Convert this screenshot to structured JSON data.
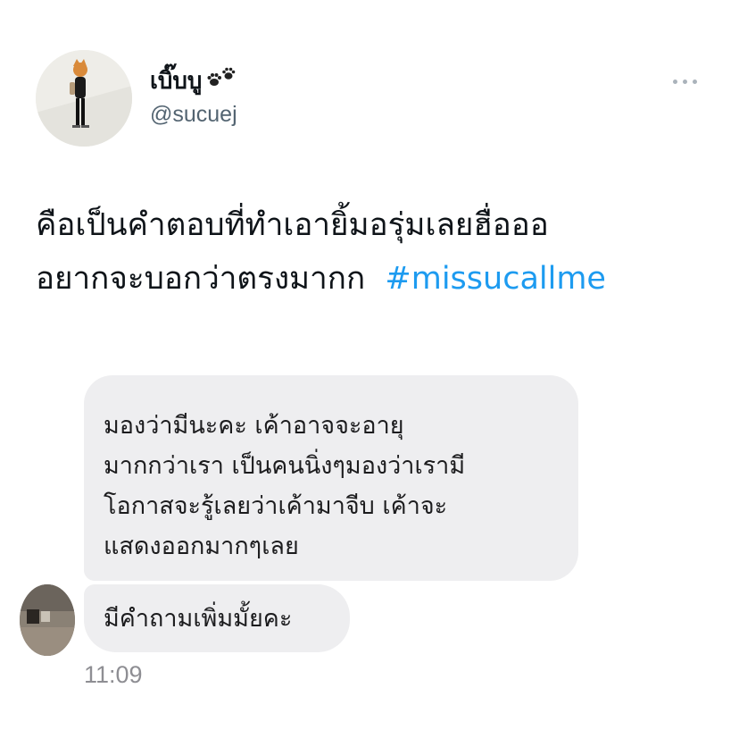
{
  "tweet": {
    "display_name": "เบิ๊บบู",
    "handle": "@sucuej",
    "text_lines": [
      "คือเป็นคำตอบที่ทำเอายิ้มอรุ่มเลยฮื่อออ",
      "อยากจะบอกว่าตรงมากก"
    ],
    "hashtag": "#missucallme",
    "icons": {
      "name_emoji": "paw-prints-icon",
      "menu": "more-icon"
    }
  },
  "chat": {
    "message_1_lines": [
      "มองว่ามีนะคะ เค้าอาจจะอายุ",
      "มากกว่าเรา เป็นคนนิ่งๆมองว่าเรามี",
      "โอกาสจะรู้เลยว่าเค้ามาจีบ เค้าจะ",
      "แสดงออกมากๆเลย"
    ],
    "message_2": "มีคำถามเพิ่มมั้ยคะ",
    "timestamp": "11:09"
  },
  "colors": {
    "hashtag": "#1d9bf0",
    "bubble": "#eeeef0",
    "handle": "#536471",
    "timestamp": "#8e8e93"
  }
}
